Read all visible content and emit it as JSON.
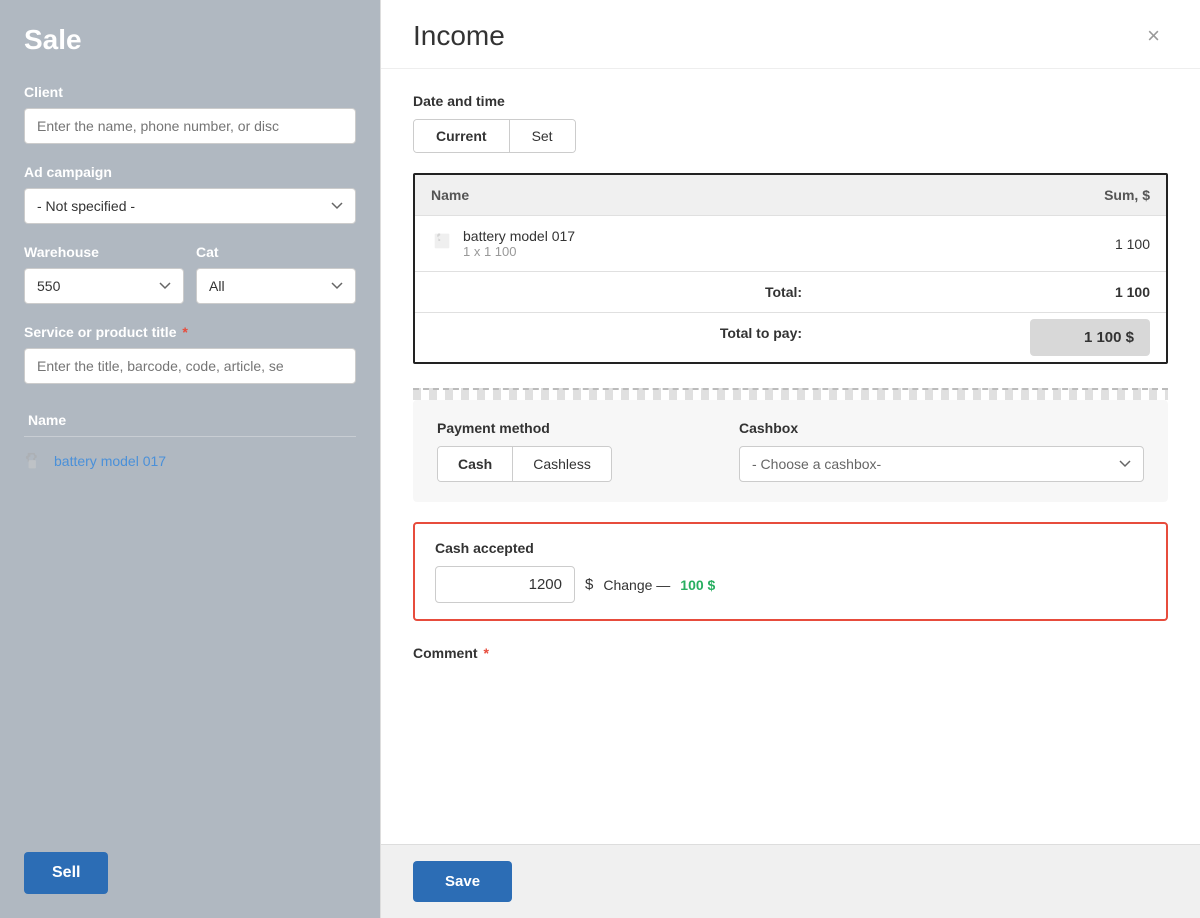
{
  "sidebar": {
    "title": "Sale",
    "client": {
      "label": "Client",
      "placeholder": "Enter the name, phone number, or disc"
    },
    "ad_campaign": {
      "label": "Ad campaign",
      "value": "- Not specified -",
      "options": [
        "- Not specified -"
      ]
    },
    "warehouse": {
      "label": "Warehouse",
      "value": "550",
      "options": [
        "550"
      ]
    },
    "category": {
      "label": "Cat",
      "value": "All",
      "options": [
        "All"
      ]
    },
    "product_title": {
      "label": "Service or product title",
      "placeholder": "Enter the title, barcode, code, article, se"
    },
    "table": {
      "name_col": "Name",
      "product_name": "battery model 017"
    },
    "sell_button": "Sell"
  },
  "modal": {
    "title": "Income",
    "close_label": "×",
    "date_time": {
      "section_label": "Date and time",
      "current_label": "Current",
      "set_label": "Set"
    },
    "receipt": {
      "col_name": "Name",
      "col_sum": "Sum, $",
      "product_name": "battery model 017",
      "product_qty": "1 x 1 100",
      "product_sum": "1 100",
      "total_label": "Total:",
      "total_value": "1 100",
      "total_pay_label": "Total to pay:",
      "total_pay_value": "1 100 $"
    },
    "payment": {
      "method_label": "Payment method",
      "cash_label": "Cash",
      "cashless_label": "Cashless",
      "cashbox_label": "Cashbox",
      "cashbox_placeholder": "- Choose a cashbox-"
    },
    "cash_accepted": {
      "label": "Cash accepted",
      "input_value": "1200",
      "currency": "$",
      "change_text": "Change —",
      "change_amount": "100 $"
    },
    "comment": {
      "label": "Comment"
    },
    "save_button": "Save"
  }
}
